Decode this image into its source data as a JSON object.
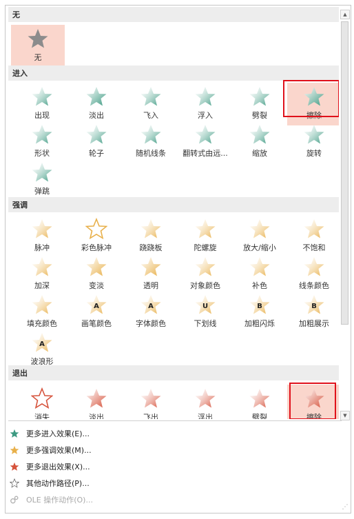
{
  "sections": {
    "none": {
      "title": "无",
      "items": [
        {
          "label": "无",
          "icon": "gray-star-icon"
        }
      ]
    },
    "entrance": {
      "title": "进入",
      "items": [
        {
          "label": "出现",
          "icon": "star-appear-icon"
        },
        {
          "label": "淡出",
          "icon": "star-fade-icon"
        },
        {
          "label": "飞入",
          "icon": "star-fly-in-icon"
        },
        {
          "label": "浮入",
          "icon": "star-float-in-icon"
        },
        {
          "label": "劈裂",
          "icon": "star-split-icon"
        },
        {
          "label": "擦除",
          "icon": "star-wipe-icon"
        },
        {
          "label": "形状",
          "icon": "star-shape-icon"
        },
        {
          "label": "轮子",
          "icon": "star-wheel-icon"
        },
        {
          "label": "随机线条",
          "icon": "star-random-bars-icon"
        },
        {
          "label": "翻转式由远...",
          "icon": "star-grow-turn-icon"
        },
        {
          "label": "缩放",
          "icon": "star-zoom-icon"
        },
        {
          "label": "旋转",
          "icon": "star-swivel-icon"
        },
        {
          "label": "弹跳",
          "icon": "star-bounce-icon"
        }
      ]
    },
    "emphasis": {
      "title": "强调",
      "items": [
        {
          "label": "脉冲",
          "icon": "star-pulse-icon"
        },
        {
          "label": "彩色脉冲",
          "icon": "star-color-pulse-icon"
        },
        {
          "label": "跷跷板",
          "icon": "star-teeter-icon"
        },
        {
          "label": "陀螺旋",
          "icon": "star-spin-icon"
        },
        {
          "label": "放大/缩小",
          "icon": "star-grow-shrink-icon"
        },
        {
          "label": "不饱和",
          "icon": "star-desaturate-icon"
        },
        {
          "label": "加深",
          "icon": "star-darken-icon"
        },
        {
          "label": "变淡",
          "icon": "star-lighten-icon"
        },
        {
          "label": "透明",
          "icon": "star-transparency-icon"
        },
        {
          "label": "对象颜色",
          "icon": "star-object-color-icon"
        },
        {
          "label": "补色",
          "icon": "star-complementary-icon"
        },
        {
          "label": "线条颜色",
          "icon": "star-line-color-icon"
        },
        {
          "label": "填充颜色",
          "icon": "star-fill-color-icon"
        },
        {
          "label": "画笔颜色",
          "icon": "star-brush-color-icon"
        },
        {
          "label": "字体颜色",
          "icon": "star-font-color-icon"
        },
        {
          "label": "下划线",
          "icon": "star-underline-icon"
        },
        {
          "label": "加粗闪烁",
          "icon": "star-bold-flash-icon"
        },
        {
          "label": "加粗展示",
          "icon": "star-bold-reveal-icon"
        },
        {
          "label": "波浪形",
          "icon": "star-wave-icon"
        }
      ]
    },
    "exit": {
      "title": "退出",
      "items": [
        {
          "label": "消失",
          "icon": "star-disappear-icon"
        },
        {
          "label": "淡出",
          "icon": "star-fade-out-icon"
        },
        {
          "label": "飞出",
          "icon": "star-fly-out-icon"
        },
        {
          "label": "浮出",
          "icon": "star-float-out-icon"
        },
        {
          "label": "劈裂",
          "icon": "star-split-out-icon"
        },
        {
          "label": "擦除",
          "icon": "star-wipe-out-icon"
        }
      ]
    }
  },
  "menu": [
    {
      "label": "更多进入效果(E)...",
      "icon": "green-star-icon",
      "enabled": true
    },
    {
      "label": "更多强调效果(M)...",
      "icon": "gold-star-icon",
      "enabled": true
    },
    {
      "label": "更多退出效果(X)...",
      "icon": "red-star-icon",
      "enabled": true
    },
    {
      "label": "其他动作路径(P)...",
      "icon": "outline-star-icon",
      "enabled": true
    },
    {
      "label": "OLE 操作动作(O)...",
      "icon": "ole-action-icon",
      "enabled": false
    }
  ],
  "colors": {
    "entrance": "#3d9a82",
    "emphasis": "#e8b04a",
    "exit": "#d6533c",
    "none": "#8c8c8c",
    "selected_bg": "#fad6cc",
    "highlight_border": "#e0101a",
    "header_bg": "#ededed"
  }
}
